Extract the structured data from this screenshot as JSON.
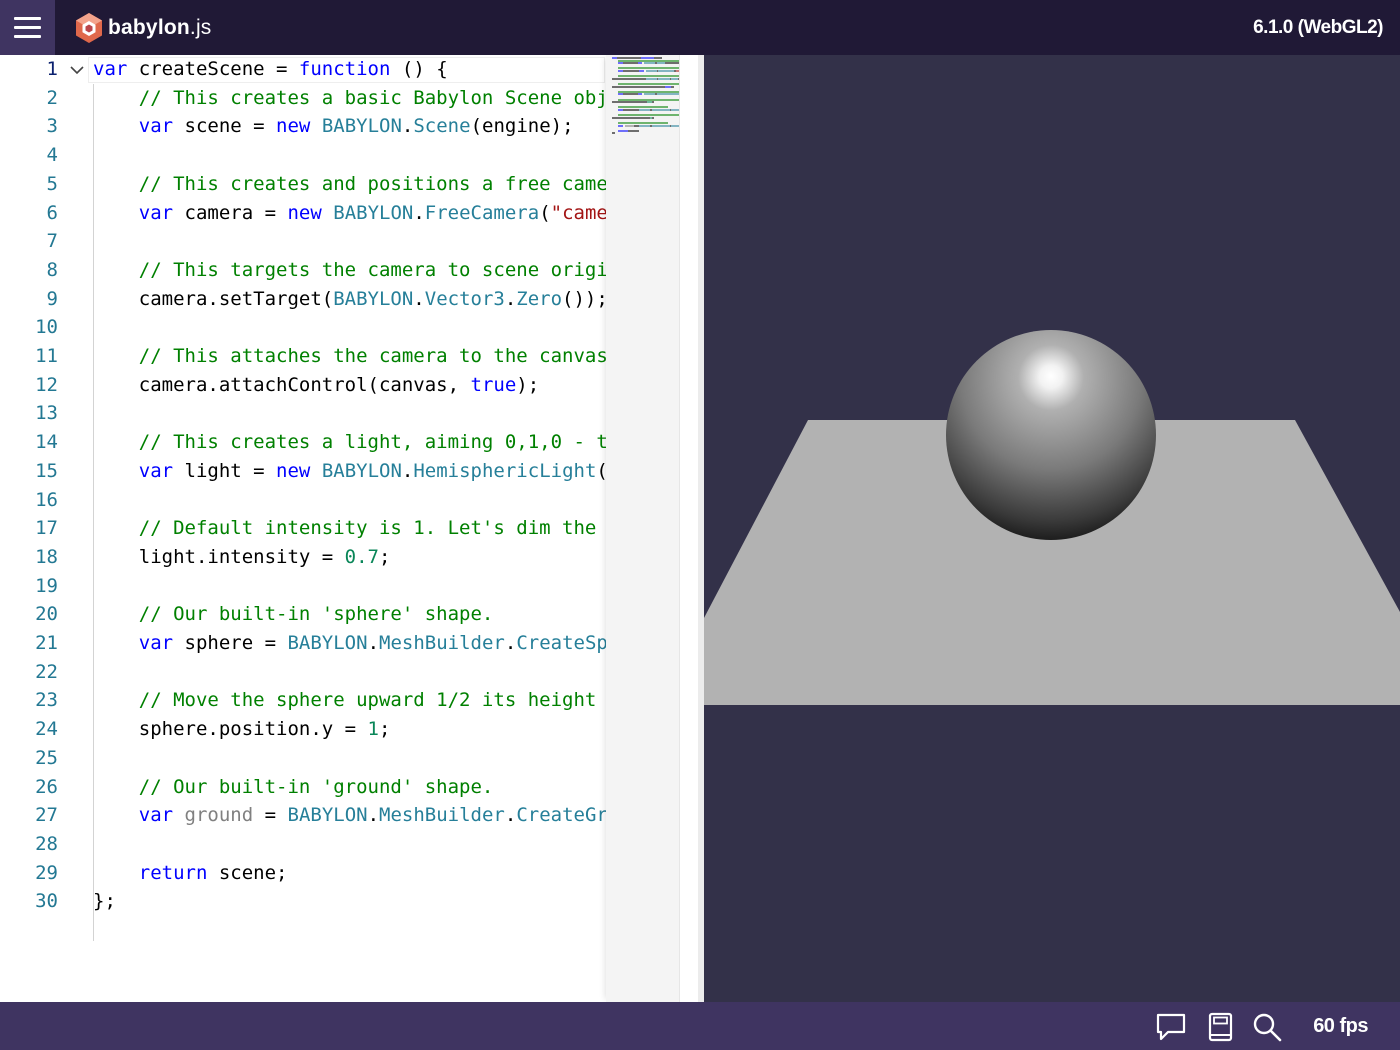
{
  "header": {
    "logo_brand": "babylon",
    "logo_suffix": ".js",
    "version": "6.1.0 (WebGL2)"
  },
  "editor": {
    "line_numbers": [
      "1",
      "2",
      "3",
      "4",
      "5",
      "6",
      "7",
      "8",
      "9",
      "10",
      "11",
      "12",
      "13",
      "14",
      "15",
      "16",
      "17",
      "18",
      "19",
      "20",
      "21",
      "22",
      "23",
      "24",
      "25",
      "26",
      "27",
      "28",
      "29",
      "30"
    ],
    "lines": [
      [
        {
          "t": "var",
          "c": "k"
        },
        {
          "t": " createScene = ",
          "c": ""
        },
        {
          "t": "function",
          "c": "k"
        },
        {
          "t": " () {",
          "c": ""
        }
      ],
      [
        {
          "t": "    ",
          "c": ""
        },
        {
          "t": "// This creates a basic Babylon Scene obj",
          "c": "c"
        }
      ],
      [
        {
          "t": "    ",
          "c": ""
        },
        {
          "t": "var",
          "c": "k"
        },
        {
          "t": " scene = ",
          "c": ""
        },
        {
          "t": "new",
          "c": "k"
        },
        {
          "t": " ",
          "c": ""
        },
        {
          "t": "BABYLON",
          "c": "t"
        },
        {
          "t": ".",
          "c": ""
        },
        {
          "t": "Scene",
          "c": "t"
        },
        {
          "t": "(engine);",
          "c": ""
        }
      ],
      [],
      [
        {
          "t": "    ",
          "c": ""
        },
        {
          "t": "// This creates and positions a free came",
          "c": "c"
        }
      ],
      [
        {
          "t": "    ",
          "c": ""
        },
        {
          "t": "var",
          "c": "k"
        },
        {
          "t": " camera = ",
          "c": ""
        },
        {
          "t": "new",
          "c": "k"
        },
        {
          "t": " ",
          "c": ""
        },
        {
          "t": "BABYLON",
          "c": "t"
        },
        {
          "t": ".",
          "c": ""
        },
        {
          "t": "FreeCamera",
          "c": "t"
        },
        {
          "t": "(",
          "c": ""
        },
        {
          "t": "\"came",
          "c": "s"
        }
      ],
      [],
      [
        {
          "t": "    ",
          "c": ""
        },
        {
          "t": "// This targets the camera to scene origi",
          "c": "c"
        }
      ],
      [
        {
          "t": "    camera.setTarget(",
          "c": ""
        },
        {
          "t": "BABYLON",
          "c": "t"
        },
        {
          "t": ".",
          "c": ""
        },
        {
          "t": "Vector3",
          "c": "t"
        },
        {
          "t": ".",
          "c": ""
        },
        {
          "t": "Zero",
          "c": "t"
        },
        {
          "t": "());",
          "c": ""
        }
      ],
      [],
      [
        {
          "t": "    ",
          "c": ""
        },
        {
          "t": "// This attaches the camera to the canvas",
          "c": "c"
        }
      ],
      [
        {
          "t": "    camera.attachControl(canvas, ",
          "c": ""
        },
        {
          "t": "true",
          "c": "k"
        },
        {
          "t": ");",
          "c": ""
        }
      ],
      [],
      [
        {
          "t": "    ",
          "c": ""
        },
        {
          "t": "// This creates a light, aiming 0,1,0 - t",
          "c": "c"
        }
      ],
      [
        {
          "t": "    ",
          "c": ""
        },
        {
          "t": "var",
          "c": "k"
        },
        {
          "t": " light = ",
          "c": ""
        },
        {
          "t": "new",
          "c": "k"
        },
        {
          "t": " ",
          "c": ""
        },
        {
          "t": "BABYLON",
          "c": "t"
        },
        {
          "t": ".",
          "c": ""
        },
        {
          "t": "HemisphericLight",
          "c": "t"
        },
        {
          "t": "(",
          "c": ""
        }
      ],
      [],
      [
        {
          "t": "    ",
          "c": ""
        },
        {
          "t": "// Default intensity is 1. Let's dim the",
          "c": "c"
        }
      ],
      [
        {
          "t": "    light.intensity = ",
          "c": ""
        },
        {
          "t": "0.7",
          "c": "n"
        },
        {
          "t": ";",
          "c": ""
        }
      ],
      [],
      [
        {
          "t": "    ",
          "c": ""
        },
        {
          "t": "// Our built-in 'sphere' shape.",
          "c": "c"
        }
      ],
      [
        {
          "t": "    ",
          "c": ""
        },
        {
          "t": "var",
          "c": "k"
        },
        {
          "t": " sphere = ",
          "c": ""
        },
        {
          "t": "BABYLON",
          "c": "t"
        },
        {
          "t": ".",
          "c": ""
        },
        {
          "t": "MeshBuilder",
          "c": "t"
        },
        {
          "t": ".",
          "c": ""
        },
        {
          "t": "CreateSp",
          "c": "t"
        }
      ],
      [],
      [
        {
          "t": "    ",
          "c": ""
        },
        {
          "t": "// Move the sphere upward 1/2 its height",
          "c": "c"
        }
      ],
      [
        {
          "t": "    sphere.position.y = ",
          "c": ""
        },
        {
          "t": "1",
          "c": "n"
        },
        {
          "t": ";",
          "c": ""
        }
      ],
      [],
      [
        {
          "t": "    ",
          "c": ""
        },
        {
          "t": "// Our built-in 'ground' shape.",
          "c": "c"
        }
      ],
      [
        {
          "t": "    ",
          "c": ""
        },
        {
          "t": "var",
          "c": "k"
        },
        {
          "t": " ",
          "c": ""
        },
        {
          "t": "ground",
          "c": "g"
        },
        {
          "t": " = ",
          "c": ""
        },
        {
          "t": "BABYLON",
          "c": "t"
        },
        {
          "t": ".",
          "c": ""
        },
        {
          "t": "MeshBuilder",
          "c": "t"
        },
        {
          "t": ".",
          "c": ""
        },
        {
          "t": "CreateGr",
          "c": "t"
        }
      ],
      [],
      [
        {
          "t": "    ",
          "c": ""
        },
        {
          "t": "return",
          "c": "k"
        },
        {
          "t": " scene;",
          "c": ""
        }
      ],
      [
        {
          "t": "};",
          "c": ""
        }
      ]
    ]
  },
  "footer": {
    "fps": "60 fps"
  },
  "colors": {
    "header_bg": "#201936",
    "footer_bg": "#3f3461",
    "canvas_bg": "#333149",
    "keyword": "#0000ff",
    "comment": "#008000",
    "type": "#267f99",
    "number": "#098658",
    "line_number": "#237893"
  },
  "icons": [
    "hamburger-menu-icon",
    "babylon-logo-icon",
    "chevron-down-icon",
    "comment-icon",
    "book-icon",
    "search-icon"
  ]
}
